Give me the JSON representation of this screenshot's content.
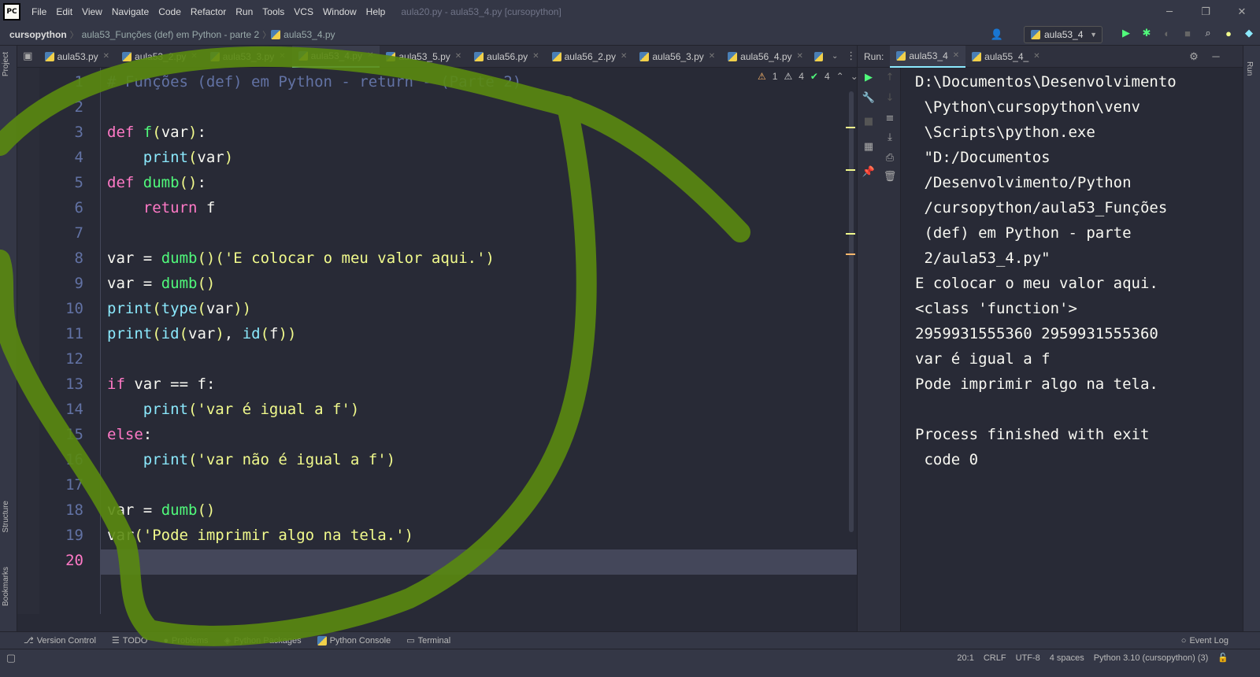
{
  "app": {
    "logo_text": "PC",
    "window_title": "aula20.py - aula53_4.py [cursopython]",
    "menu": [
      "File",
      "Edit",
      "View",
      "Navigate",
      "Code",
      "Refactor",
      "Run",
      "Tools",
      "VCS",
      "Window",
      "Help"
    ]
  },
  "breadcrumb": {
    "project": "cursopython",
    "folder": "aula53_Funções (def) em Python - parte 2",
    "file": "aula53_4.py"
  },
  "run_config": {
    "selected": "aula53_4"
  },
  "side_tools": {
    "project": "Project",
    "structure": "Structure",
    "bookmarks": "Bookmarks",
    "run": "Run"
  },
  "tabs": [
    {
      "label": "aula53.py"
    },
    {
      "label": "aula53_2.py"
    },
    {
      "label": "aula53_3.py"
    },
    {
      "label": "aula53_4.py",
      "active": true
    },
    {
      "label": "aula53_5.py"
    },
    {
      "label": "aula56.py"
    },
    {
      "label": "aula56_2.py"
    },
    {
      "label": "aula56_3.py"
    },
    {
      "label": "aula56_4.py"
    }
  ],
  "inspections": {
    "warnings_a": "1",
    "warnings_b": "4",
    "ok": "4"
  },
  "code": {
    "current_line": 20,
    "line_numbers": [
      "1",
      "2",
      "3",
      "4",
      "5",
      "6",
      "7",
      "8",
      "9",
      "10",
      "11",
      "12",
      "13",
      "14",
      "15",
      "16",
      "17",
      "18",
      "19",
      "20"
    ],
    "lines": [
      "# Funções (def) em Python - return - (Parte 2)",
      "",
      "def f(var):",
      "    print(var)",
      "def dumb():",
      "    return f",
      "",
      "var = dumb()('E colocar o meu valor aqui.')",
      "var = dumb()",
      "print(type(var))",
      "print(id(var), id(f))",
      "",
      "if var == f:",
      "    print('var é igual a f')",
      "else:",
      "    print('var não é igual a f')",
      "",
      "var = dumb()",
      "var('Pode imprimir algo na tela.')",
      ""
    ]
  },
  "run_panel": {
    "label": "Run:",
    "tabs": [
      "aula53_4",
      "aula55_4_"
    ],
    "output": [
      "D:\\Documentos\\Desenvolvimento",
      " \\Python\\cursopython\\venv",
      " \\Scripts\\python.exe",
      " \"D:/Documentos",
      " /Desenvolvimento/Python",
      " /cursopython/aula53_Funções",
      " (def) em Python - parte",
      " 2/aula53_4.py\"",
      "E colocar o meu valor aqui.",
      "<class 'function'>",
      "2959931555360 2959931555360",
      "var é igual a f",
      "Pode imprimir algo na tela.",
      "",
      "Process finished with exit",
      " code 0"
    ]
  },
  "bottom_tools": [
    "Version Control",
    "TODO",
    "Problems",
    "Python Packages",
    "Python Console",
    "Terminal"
  ],
  "event_log": "Event Log",
  "status": {
    "position": "20:1",
    "line_sep": "CRLF",
    "encoding": "UTF-8",
    "indent": "4 spaces",
    "interpreter": "Python 3.10 (cursopython) (3)"
  },
  "colors": {
    "bg": "#282a36",
    "comment": "#6272a4",
    "keyword": "#ff79c6",
    "function": "#50fa7b",
    "string": "#f1fa8c",
    "builtin": "#8be9fd",
    "annotation": "#5a8a10"
  }
}
